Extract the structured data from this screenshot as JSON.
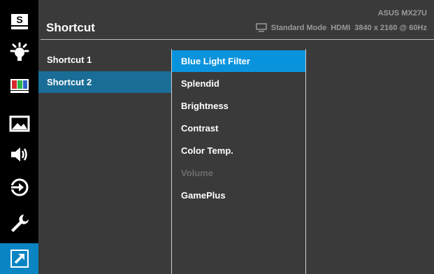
{
  "header": {
    "title": "Shortcut",
    "model": "ASUS MX27U",
    "mode": "Standard Mode",
    "input": "HDMI",
    "resolution": "3840 x 2160 @ 60Hz"
  },
  "sidebar": {
    "items": [
      {
        "name": "splendid-icon",
        "label": "S"
      },
      {
        "name": "brightness-icon"
      },
      {
        "name": "color-icon"
      },
      {
        "name": "image-icon"
      },
      {
        "name": "sound-icon"
      },
      {
        "name": "input-select-icon"
      },
      {
        "name": "system-setup-icon"
      },
      {
        "name": "shortcut-icon",
        "active": true
      }
    ]
  },
  "level1": {
    "items": [
      {
        "label": "Shortcut 1",
        "selected": false
      },
      {
        "label": "Shortcut 2",
        "selected": true
      }
    ]
  },
  "level2": {
    "items": [
      {
        "label": "Blue Light Filter",
        "selected": true,
        "enabled": true
      },
      {
        "label": "Splendid",
        "selected": false,
        "enabled": true
      },
      {
        "label": "Brightness",
        "selected": false,
        "enabled": true
      },
      {
        "label": "Contrast",
        "selected": false,
        "enabled": true
      },
      {
        "label": "Color Temp.",
        "selected": false,
        "enabled": true
      },
      {
        "label": "Volume",
        "selected": false,
        "enabled": false
      },
      {
        "label": "GamePlus",
        "selected": false,
        "enabled": true
      }
    ]
  },
  "colors": {
    "accent": "#0a93dd",
    "active_icon_bg": "#0a84c2",
    "level1_selected": "#1a6d97",
    "panel_bg": "#3a3a3a",
    "sidebar_bg": "#000000"
  }
}
